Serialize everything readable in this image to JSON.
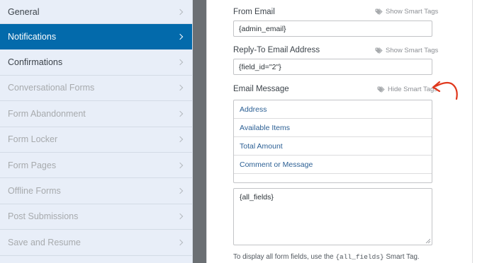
{
  "sidebar": {
    "items": [
      {
        "label": "General",
        "state": "normal"
      },
      {
        "label": "Notifications",
        "state": "active"
      },
      {
        "label": "Confirmations",
        "state": "normal"
      },
      {
        "label": "Conversational Forms",
        "state": "muted"
      },
      {
        "label": "Form Abandonment",
        "state": "muted"
      },
      {
        "label": "Form Locker",
        "state": "muted"
      },
      {
        "label": "Form Pages",
        "state": "muted"
      },
      {
        "label": "Offline Forms",
        "state": "muted"
      },
      {
        "label": "Post Submissions",
        "state": "muted"
      },
      {
        "label": "Save and Resume",
        "state": "muted"
      }
    ]
  },
  "form": {
    "from_email": {
      "label": "From Email",
      "smart_tags_label": "Show Smart Tags",
      "value": "{admin_email}"
    },
    "reply_to": {
      "label": "Reply-To Email Address",
      "smart_tags_label": "Show Smart Tags",
      "value": "{field_id=\"2\"}"
    },
    "email_message": {
      "label": "Email Message",
      "smart_tags_label": "Hide Smart Tags",
      "smart_tags": [
        "Address",
        "Available Items",
        "Total Amount",
        "Comment or Message"
      ],
      "value": "{all_fields}",
      "help_prefix": "To display all form fields, use the",
      "help_code": "{all_fields}",
      "help_suffix": "Smart Tag."
    }
  },
  "colors": {
    "sidebar_bg": "#e8eef8",
    "active_bg": "#036aab",
    "gutter": "#6b6f73",
    "tag_link": "#2b5f94",
    "arrow": "#e0371c"
  },
  "icons": {
    "chevron": "chevron-right-icon",
    "tag": "tag-icon",
    "arrow": "curved-arrow-annotation"
  }
}
